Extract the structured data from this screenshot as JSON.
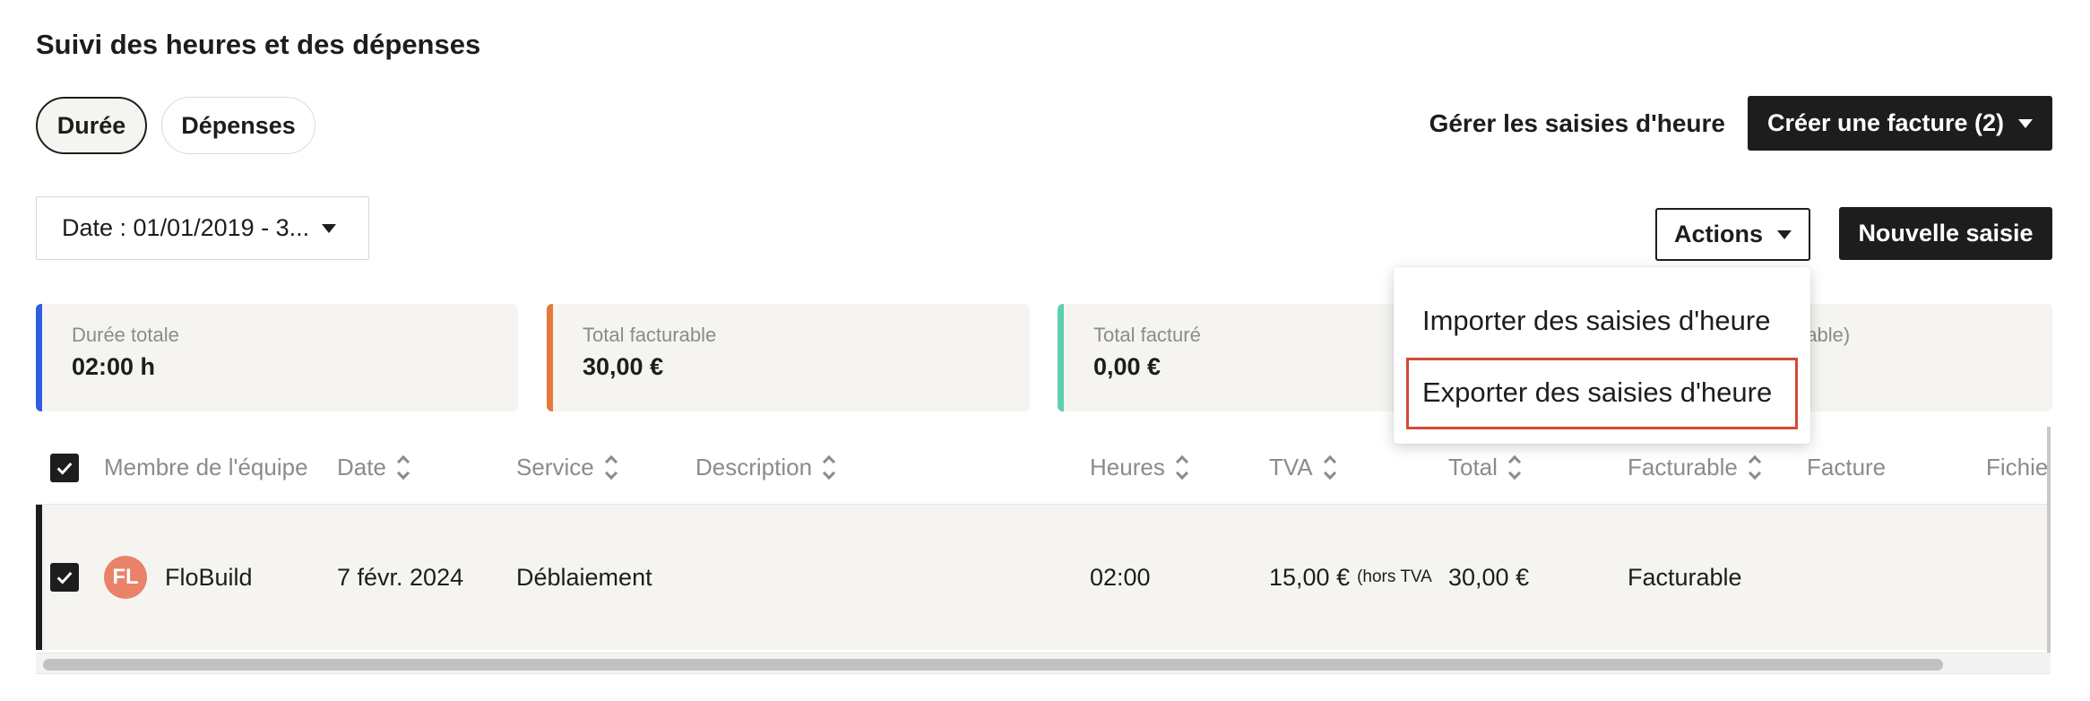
{
  "page": {
    "title": "Suivi des heures et des dépenses"
  },
  "tabs": [
    {
      "label": "Durée",
      "active": true
    },
    {
      "label": "Dépenses",
      "active": false
    }
  ],
  "header_actions": {
    "manage_link": "Gérer les saisies d'heure",
    "create_invoice": "Créer une facture (2)"
  },
  "filters": {
    "date": "Date : 01/01/2019 - 3..."
  },
  "toolbar": {
    "actions": "Actions",
    "new_entry": "Nouvelle saisie"
  },
  "actions_menu": {
    "items": [
      "Importer des saisies d'heure",
      "Exporter des saisies d'heure"
    ],
    "highlighted_index": 1
  },
  "stats": [
    {
      "label": "Durée totale",
      "value": "02:00 h",
      "color": "#2f5fe0"
    },
    {
      "label": "Total facturable",
      "value": "30,00 €",
      "color": "#e37a3b"
    },
    {
      "label": "Total facturé",
      "value": "0,00 €",
      "color": "#5fcfae"
    },
    {
      "label": "rable)",
      "value": ""
    }
  ],
  "table": {
    "columns": [
      "Membre de l'équipe",
      "Date",
      "Service",
      "Description",
      "Heures",
      "TVA",
      "Total",
      "Facturable",
      "Facture",
      "Fichie"
    ],
    "rows": [
      {
        "initials": "FL",
        "member": "FloBuild",
        "date": "7 févr. 2024",
        "service": "Déblaiement",
        "description": "",
        "hours": "02:00",
        "tva": "15,00 €",
        "tva_note": "(hors TVA",
        "total": "30,00 €",
        "billable": "Facturable",
        "invoice": "",
        "file": ""
      }
    ]
  },
  "colors": {
    "accent_dark": "#1d1d1d",
    "highlight": "#d24a36",
    "avatar": "#e98269"
  }
}
